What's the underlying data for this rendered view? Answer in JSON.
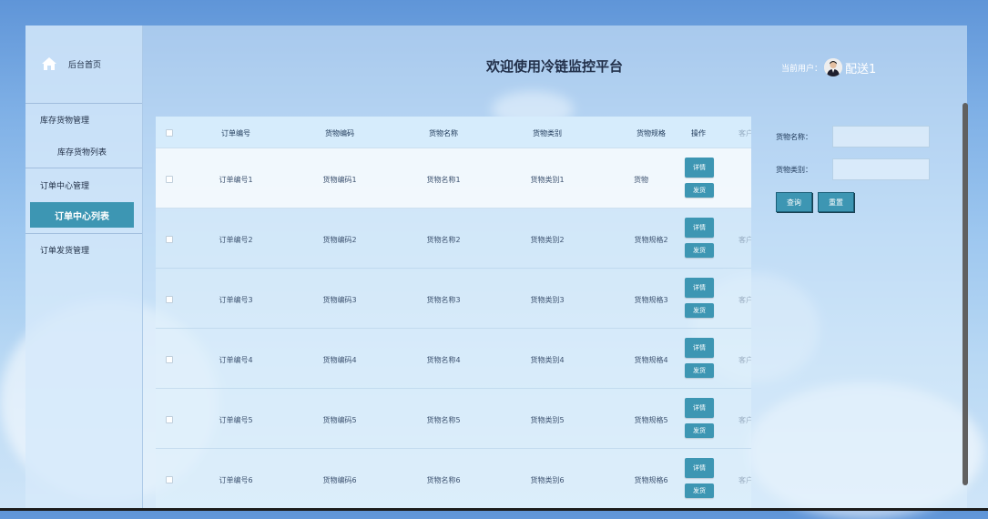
{
  "sidebar": {
    "home_label": "后台首页",
    "menu": [
      {
        "label": "库存货物管理"
      },
      {
        "label": "库存货物列表"
      },
      {
        "label": "订单中心管理"
      },
      {
        "label": "订单中心列表"
      },
      {
        "label": "订单发货管理"
      }
    ]
  },
  "header": {
    "title": "欢迎使用冷链监控平台",
    "user_label": "当前用户：",
    "user_name": "配送1"
  },
  "table": {
    "columns": [
      "订单编号",
      "货物编码",
      "货物名称",
      "货物类别",
      "货物规格",
      "操作",
      "客户"
    ],
    "rows": [
      {
        "order_no": "订单编号1",
        "code": "货物编码1",
        "name": "货物名称1",
        "category": "货物类别1",
        "spec": "货物"
      },
      {
        "order_no": "订单编号2",
        "code": "货物编码2",
        "name": "货物名称2",
        "category": "货物类别2",
        "spec": "货物规格2"
      },
      {
        "order_no": "订单编号3",
        "code": "货物编码3",
        "name": "货物名称3",
        "category": "货物类别3",
        "spec": "货物规格3"
      },
      {
        "order_no": "订单编号4",
        "code": "货物编码4",
        "name": "货物名称4",
        "category": "货物类别4",
        "spec": "货物规格4"
      },
      {
        "order_no": "订单编号5",
        "code": "货物编码5",
        "name": "货物名称5",
        "category": "货物类别5",
        "spec": "货物规格5"
      },
      {
        "order_no": "订单编号6",
        "code": "货物编码6",
        "name": "货物名称6",
        "category": "货物类别6",
        "spec": "货物规格6"
      }
    ],
    "detail_label": "详情",
    "ship_label": "发货",
    "customer_label": "客户"
  },
  "search": {
    "name_label": "货物名称：",
    "category_label": "货物类别：",
    "query_label": "查询",
    "reset_label": "重置"
  },
  "colors": {
    "accent": "#3d96b3",
    "sky_top": "#5f95d8"
  }
}
